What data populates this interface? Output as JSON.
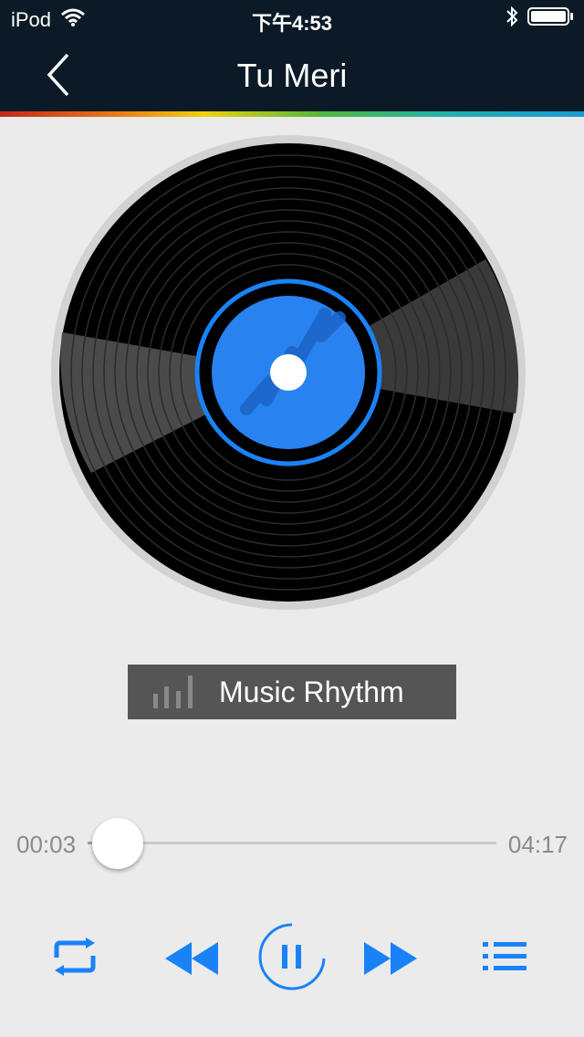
{
  "status": {
    "carrier": "iPod",
    "time": "下午4:53"
  },
  "header": {
    "title": "Tu Meri"
  },
  "rhythm": {
    "label": "Music Rhythm"
  },
  "player": {
    "current": "00:03",
    "total": "04:17",
    "progress": 0.012
  },
  "colors": {
    "accent": "#1a82f7",
    "bar": "#0c1a27"
  }
}
